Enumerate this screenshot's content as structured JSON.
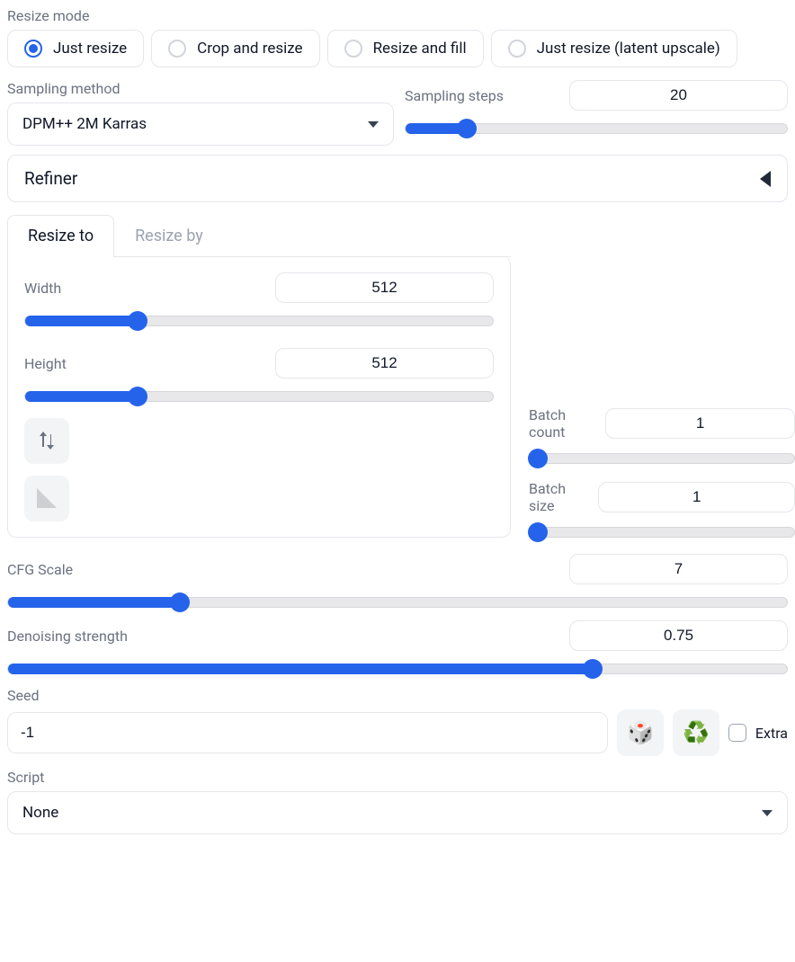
{
  "resize_mode": {
    "label": "Resize mode",
    "options": [
      "Just resize",
      "Crop and resize",
      "Resize and fill",
      "Just resize (latent upscale)"
    ],
    "selected": 0
  },
  "sampling_method": {
    "label": "Sampling method",
    "value": "DPM++ 2M Karras"
  },
  "sampling_steps": {
    "label": "Sampling steps",
    "value": 20,
    "min": 1,
    "max": 150,
    "pct": 16
  },
  "refiner": {
    "label": "Refiner"
  },
  "resize_tabs": {
    "tabs": [
      "Resize to",
      "Resize by"
    ],
    "active": 0
  },
  "width": {
    "label": "Width",
    "value": 512,
    "pct": 24
  },
  "height": {
    "label": "Height",
    "value": 512,
    "pct": 24
  },
  "batch_count": {
    "label": "Batch count",
    "value": 1,
    "pct": 3
  },
  "batch_size": {
    "label": "Batch size",
    "value": 1,
    "pct": 3
  },
  "cfg": {
    "label": "CFG Scale",
    "value": 7,
    "pct": 22
  },
  "denoise": {
    "label": "Denoising strength",
    "value": 0.75,
    "pct": 75
  },
  "seed": {
    "label": "Seed",
    "value": "-1",
    "extra_label": "Extra"
  },
  "script": {
    "label": "Script",
    "value": "None"
  }
}
